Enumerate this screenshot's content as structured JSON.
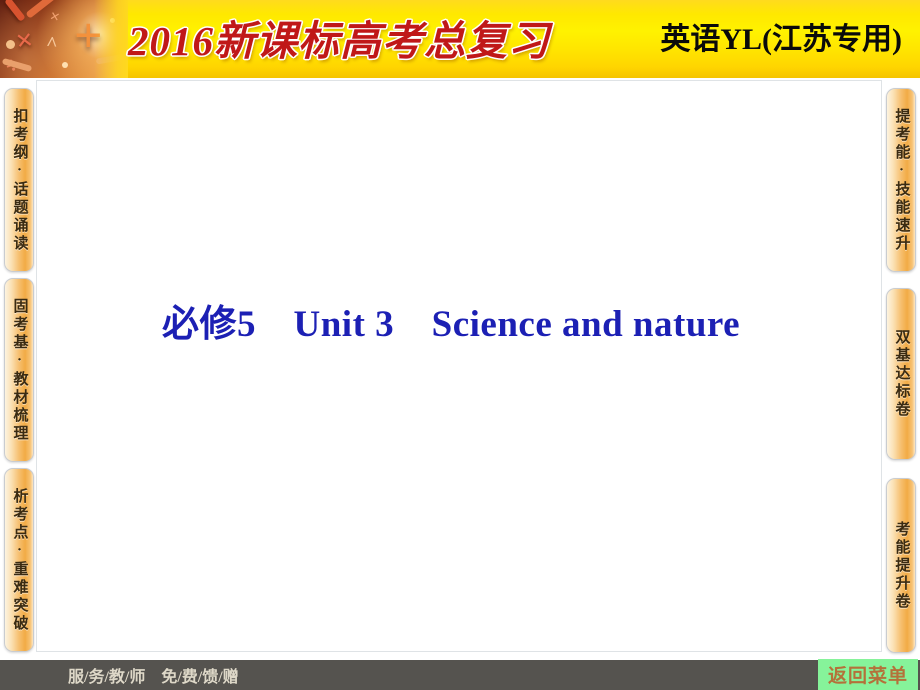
{
  "header": {
    "series_title": "2016新课标高考总复习",
    "edition": "英语YL(江苏专用)",
    "artwork_name": "math-symbols-artwork",
    "background_color": "#fff200",
    "title_color": "#c01818"
  },
  "main": {
    "slide_title": "必修5　Unit 3　Science and nature",
    "slide_title_color": "#1c20b4",
    "background_color": "#ffffff"
  },
  "left_tabs": [
    {
      "label": "扣考纲·话题诵读"
    },
    {
      "label": "固考基·教材梳理"
    },
    {
      "label": "析考点·重难突破"
    }
  ],
  "right_tabs": [
    {
      "label": "提考能·技能速升"
    },
    {
      "label": "双基达标卷"
    },
    {
      "label": "考能提升卷"
    }
  ],
  "footer": {
    "promo_text": "服/务/教/师    免/费/馈/赠",
    "background_color": "#55534f",
    "text_color": "#ded8c8",
    "menu_button": {
      "label": "返回菜单",
      "background_color": "#86f39a",
      "text_color": "#b4713a"
    }
  },
  "decor": {
    "multiply_1": "×",
    "multiply_2": "×",
    "caret": "^",
    "plus": "+",
    "divide": "÷"
  }
}
